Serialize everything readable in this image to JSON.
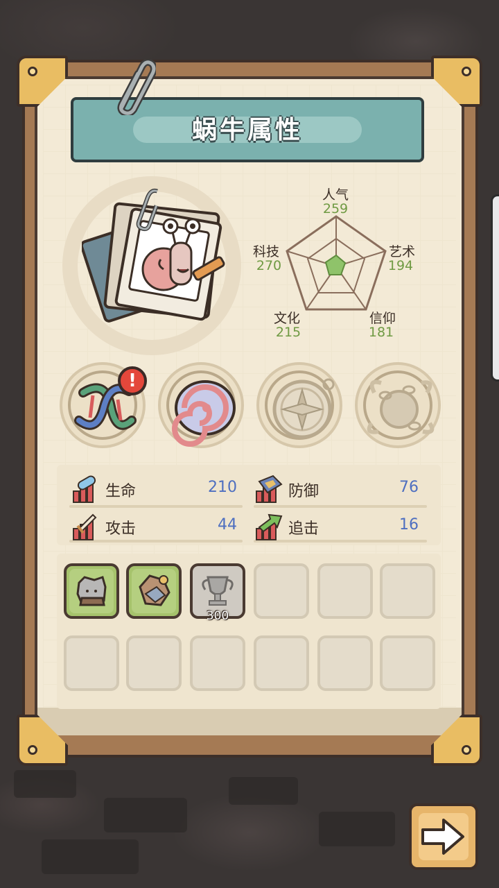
{
  "title": "蜗牛属性",
  "radar": {
    "stats": [
      {
        "label": "人气",
        "value": "259"
      },
      {
        "label": "艺术",
        "value": "194"
      },
      {
        "label": "信仰",
        "value": "181"
      },
      {
        "label": "文化",
        "value": "215"
      },
      {
        "label": "科技",
        "value": "270"
      }
    ]
  },
  "equipment": [
    {
      "name": "dna-gene",
      "alert": "!"
    },
    {
      "name": "shell"
    },
    {
      "name": "compass"
    },
    {
      "name": "chained-orb"
    }
  ],
  "stats": {
    "hp": {
      "label": "生命",
      "value": "210"
    },
    "defense": {
      "label": "防御",
      "value": "76"
    },
    "attack": {
      "label": "攻击",
      "value": "44"
    },
    "chase": {
      "label": "追击",
      "value": "16"
    }
  },
  "inventory": {
    "slots_row1": [
      "stone-relic",
      "rock-item",
      "trophy",
      "",
      "",
      ""
    ],
    "slots_row2": [
      "",
      "",
      "",
      "",
      "",
      ""
    ],
    "trophy_count": "300"
  },
  "colors": {
    "banner": "#7bb1ae",
    "stat_value": "#4e6fc0",
    "radar_value": "#6f9a43",
    "paper": "#f3ead6",
    "board": "#a57a54",
    "corner": "#e9bd63"
  },
  "next_button_icon": "arrow-right-icon"
}
